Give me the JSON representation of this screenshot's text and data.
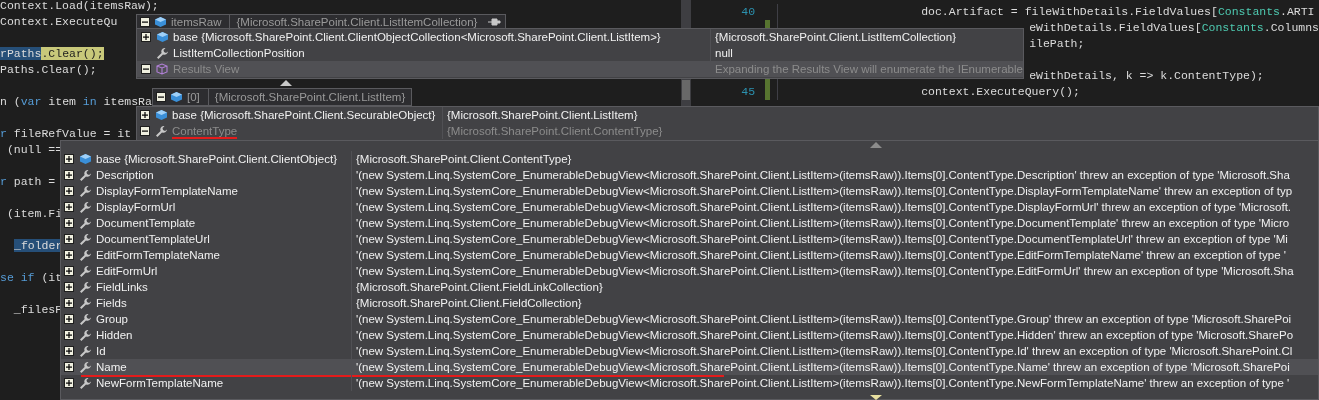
{
  "editor": {
    "left_lines": [
      {
        "kind": "code",
        "segments": [
          {
            "kind": "plain",
            "text": "Context.Load(itemsRaw);"
          }
        ]
      },
      {
        "kind": "code",
        "segments": [
          {
            "kind": "plain",
            "text": "Context.ExecuteQu"
          }
        ]
      },
      {
        "kind": "blank"
      },
      {
        "kind": "code",
        "segments": [
          {
            "kind": "reference",
            "text": "rPaths"
          },
          {
            "kind": "highlight",
            "text": ".Clear();"
          }
        ]
      },
      {
        "kind": "code",
        "segments": [
          {
            "kind": "plain",
            "text": "Paths.Clear();"
          }
        ]
      },
      {
        "kind": "blank"
      },
      {
        "kind": "code",
        "segments": [
          {
            "kind": "plain",
            "text": "n ("
          },
          {
            "kind": "keyword",
            "text": "var"
          },
          {
            "kind": "plain",
            "text": " item "
          },
          {
            "kind": "keyword",
            "text": "in"
          },
          {
            "kind": "plain",
            "text": " itemsRa"
          }
        ]
      },
      {
        "kind": "blank"
      },
      {
        "kind": "code",
        "segments": [
          {
            "kind": "keyword",
            "text": "r"
          },
          {
            "kind": "plain",
            "text": " fileRefValue = it"
          }
        ]
      },
      {
        "kind": "code",
        "segments": [
          {
            "kind": "plain",
            "text": " (null =="
          }
        ]
      },
      {
        "kind": "blank"
      },
      {
        "kind": "code",
        "segments": [
          {
            "kind": "keyword",
            "text": "r"
          },
          {
            "kind": "plain",
            "text": " path ="
          }
        ]
      },
      {
        "kind": "blank"
      },
      {
        "kind": "code",
        "segments": [
          {
            "kind": "plain",
            "text": " (item.Fi"
          }
        ]
      },
      {
        "kind": "blank"
      },
      {
        "kind": "code",
        "segments": [
          {
            "kind": "selection",
            "text": "_folder"
          }
        ]
      },
      {
        "kind": "blank"
      },
      {
        "kind": "code",
        "segments": [
          {
            "kind": "keyword",
            "text": "se if"
          },
          {
            "kind": "plain",
            "text": " (it"
          }
        ]
      },
      {
        "kind": "blank"
      },
      {
        "kind": "code",
        "segments": [
          {
            "kind": "plain",
            "text": "  _filesP"
          }
        ]
      }
    ],
    "right_lines": [
      {
        "kind": "full",
        "number": "40",
        "changed": false,
        "segments": [
          {
            "kind": "plain",
            "text": "doc.Artifact = fileWithDetails.FieldValues["
          },
          {
            "kind": "type",
            "text": "Constants"
          },
          {
            "kind": "plain",
            "text": ".ARTI"
          }
        ]
      },
      {
        "kind": "partial",
        "changed": true,
        "segments": [
          {
            "kind": "plain",
            "text": "eWithDetails.FieldValues["
          },
          {
            "kind": "type",
            "text": "Constants"
          },
          {
            "kind": "plain",
            "text": ".Columns"
          }
        ]
      },
      {
        "kind": "partial",
        "changed": true,
        "segments": [
          {
            "kind": "plain",
            "text": "ilePath;"
          }
        ]
      },
      {
        "kind": "blank",
        "changed": true
      },
      {
        "kind": "partial",
        "changed": true,
        "segments": [
          {
            "kind": "plain",
            "text": "eWithDetails, k => k.ContentType);"
          }
        ]
      },
      {
        "kind": "full",
        "number": "45",
        "changed": true,
        "segments": [
          {
            "kind": "plain",
            "text": "context.ExecuteQuery();"
          }
        ]
      }
    ]
  },
  "datatips": [
    {
      "header": {
        "expanded": true,
        "kind": "object",
        "name": "itemsRaw",
        "value": "{Microsoft.SharePoint.Client.ListItemCollection}"
      },
      "rows": [
        {
          "expanded": false,
          "kind": "object",
          "name": "base {Microsoft.SharePoint.Client.ClientObjectCollection<Microsoft.SharePoint.Client.ListItem>}",
          "value": "{Microsoft.SharePoint.Client.ListItemCollection}",
          "selected": false,
          "dimmed": false,
          "underlined": false
        },
        {
          "kind": "property",
          "name": "ListItemCollectionPosition",
          "value": "null",
          "selected": false,
          "dimmed": false,
          "underlined": false
        },
        {
          "expanded": true,
          "kind": "view",
          "name": "Results View",
          "value": "Expanding the Results View will enumerate the IEnumerable",
          "selected": true,
          "dimmed": true,
          "underlined": false
        }
      ]
    },
    {
      "header": {
        "expanded": true,
        "kind": "object",
        "name": "[0]",
        "value": "{Microsoft.SharePoint.Client.ListItem}"
      },
      "rows": [
        {
          "expanded": false,
          "kind": "object",
          "name": "base {Microsoft.SharePoint.Client.SecurableObject}",
          "value": "{Microsoft.SharePoint.Client.ListItem}",
          "selected": false,
          "dimmed": false,
          "underlined": false
        },
        {
          "expanded": true,
          "kind": "property",
          "name": "ContentType",
          "value": "{Microsoft.SharePoint.Client.ContentType}",
          "selected": false,
          "dimmed": true,
          "underlined": true
        }
      ]
    },
    {
      "rows": [
        {
          "expanded": false,
          "kind": "object",
          "name": "base {Microsoft.SharePoint.Client.ClientObject}",
          "value": "{Microsoft.SharePoint.Client.ContentType}",
          "selected": false,
          "dimmed": false,
          "underlined": false
        },
        {
          "expanded": false,
          "kind": "property",
          "name": "Description",
          "value": "'(new System.Linq.SystemCore_EnumerableDebugView<Microsoft.SharePoint.Client.ListItem>(itemsRaw)).Items[0].ContentType.Description' threw an exception of type 'Microsoft.Sha",
          "selected": false,
          "dimmed": false,
          "underlined": false
        },
        {
          "expanded": false,
          "kind": "property",
          "name": "DisplayFormTemplateName",
          "value": "'(new System.Linq.SystemCore_EnumerableDebugView<Microsoft.SharePoint.Client.ListItem>(itemsRaw)).Items[0].ContentType.DisplayFormTemplateName' threw an exception of typ",
          "selected": false,
          "dimmed": false,
          "underlined": false
        },
        {
          "expanded": false,
          "kind": "property",
          "name": "DisplayFormUrl",
          "value": "'(new System.Linq.SystemCore_EnumerableDebugView<Microsoft.SharePoint.Client.ListItem>(itemsRaw)).Items[0].ContentType.DisplayFormUrl' threw an exception of type 'Microsoft.",
          "selected": false,
          "dimmed": false,
          "underlined": false
        },
        {
          "expanded": false,
          "kind": "property",
          "name": "DocumentTemplate",
          "value": "'(new System.Linq.SystemCore_EnumerableDebugView<Microsoft.SharePoint.Client.ListItem>(itemsRaw)).Items[0].ContentType.DocumentTemplate' threw an exception of type 'Micro",
          "selected": false,
          "dimmed": false,
          "underlined": false
        },
        {
          "expanded": false,
          "kind": "property",
          "name": "DocumentTemplateUrl",
          "value": "'(new System.Linq.SystemCore_EnumerableDebugView<Microsoft.SharePoint.Client.ListItem>(itemsRaw)).Items[0].ContentType.DocumentTemplateUrl' threw an exception of type 'Mi",
          "selected": false,
          "dimmed": false,
          "underlined": false
        },
        {
          "expanded": false,
          "kind": "property",
          "name": "EditFormTemplateName",
          "value": "'(new System.Linq.SystemCore_EnumerableDebugView<Microsoft.SharePoint.Client.ListItem>(itemsRaw)).Items[0].ContentType.EditFormTemplateName' threw an exception of type '",
          "selected": false,
          "dimmed": false,
          "underlined": false
        },
        {
          "expanded": false,
          "kind": "property",
          "name": "EditFormUrl",
          "value": "'(new System.Linq.SystemCore_EnumerableDebugView<Microsoft.SharePoint.Client.ListItem>(itemsRaw)).Items[0].ContentType.EditFormUrl' threw an exception of type 'Microsoft.Sha",
          "selected": false,
          "dimmed": false,
          "underlined": false
        },
        {
          "expanded": false,
          "kind": "property",
          "name": "FieldLinks",
          "value": "{Microsoft.SharePoint.Client.FieldLinkCollection}",
          "selected": false,
          "dimmed": false,
          "underlined": false
        },
        {
          "expanded": false,
          "kind": "property",
          "name": "Fields",
          "value": "{Microsoft.SharePoint.Client.FieldCollection}",
          "selected": false,
          "dimmed": false,
          "underlined": false
        },
        {
          "expanded": false,
          "kind": "property",
          "name": "Group",
          "value": "'(new System.Linq.SystemCore_EnumerableDebugView<Microsoft.SharePoint.Client.ListItem>(itemsRaw)).Items[0].ContentType.Group' threw an exception of type 'Microsoft.SharePoi",
          "selected": false,
          "dimmed": false,
          "underlined": false
        },
        {
          "expanded": false,
          "kind": "property",
          "name": "Hidden",
          "value": "'(new System.Linq.SystemCore_EnumerableDebugView<Microsoft.SharePoint.Client.ListItem>(itemsRaw)).Items[0].ContentType.Hidden' threw an exception of type 'Microsoft.SharePo",
          "selected": false,
          "dimmed": false,
          "underlined": false
        },
        {
          "expanded": false,
          "kind": "property",
          "name": "Id",
          "value": "'(new System.Linq.SystemCore_EnumerableDebugView<Microsoft.SharePoint.Client.ListItem>(itemsRaw)).Items[0].ContentType.Id' threw an exception of type 'Microsoft.SharePoint.Cl",
          "selected": false,
          "dimmed": false,
          "underlined": false
        },
        {
          "expanded": false,
          "kind": "property",
          "name": "Name",
          "value": "'(new System.Linq.SystemCore_EnumerableDebugView<Microsoft.SharePoint.Client.ListItem>(itemsRaw)).Items[0].ContentType.Name' threw an exception of type 'Microsoft.SharePoi",
          "selected": true,
          "dimmed": false,
          "underlined": true
        },
        {
          "expanded": false,
          "kind": "property",
          "name": "NewFormTemplateName",
          "value": "'(new System.Linq.SystemCore_EnumerableDebugView<Microsoft.SharePoint.Client.ListItem>(itemsRaw)).Items[0].ContentType.NewFormTemplateName' threw an exception of type '",
          "selected": false,
          "dimmed": false,
          "underlined": false
        }
      ]
    }
  ]
}
